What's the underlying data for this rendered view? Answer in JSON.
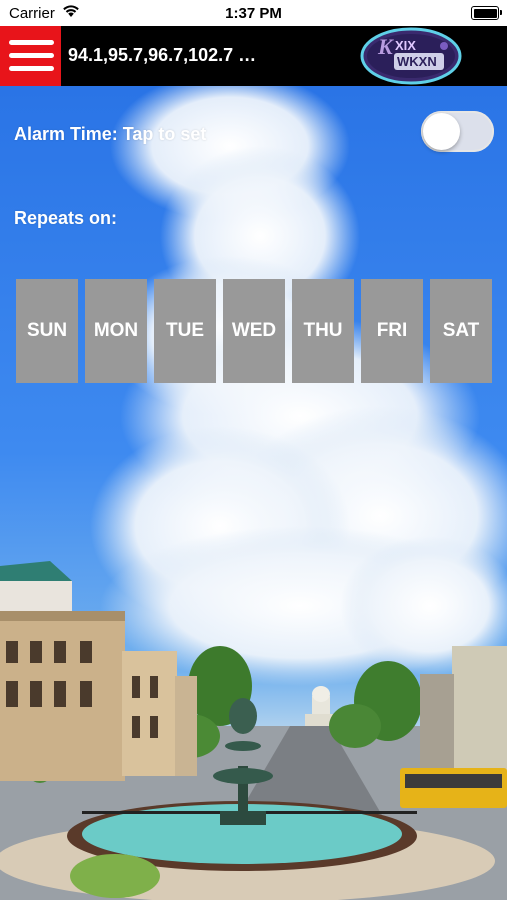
{
  "status_bar": {
    "carrier": "Carrier",
    "time": "1:37 PM",
    "icons": [
      "wifi-icon",
      "battery-icon"
    ]
  },
  "nav": {
    "station_list": "94.1,95.7,96.7,102.7 …",
    "menu_icon": "hamburger-menu-icon",
    "logo": "WKXN logo"
  },
  "alarm": {
    "label": "Alarm Time: Tap to set",
    "enabled": false,
    "repeats_label": "Repeats on:"
  },
  "days": [
    "SUN",
    "MON",
    "TUE",
    "WED",
    "THU",
    "FRI",
    "SAT"
  ],
  "colors": {
    "menu_button": "#e8141a",
    "nav_bar": "#000000",
    "day_button": "#999999",
    "sky": "#2a74e6"
  }
}
